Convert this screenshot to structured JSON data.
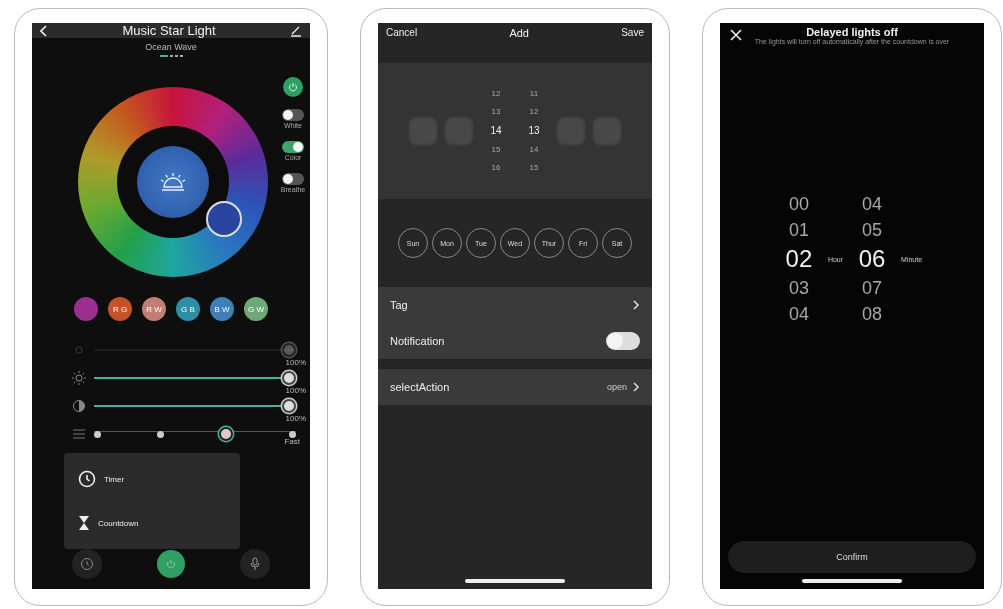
{
  "light_screen": {
    "title": "Music Star Light",
    "scene": "Ocean Wave",
    "scene_pages": [
      {
        "selected": true
      },
      {
        "selected": false
      },
      {
        "selected": false
      },
      {
        "selected": false
      }
    ],
    "power": {
      "on": true
    },
    "modes": [
      {
        "label": "White",
        "on": false
      },
      {
        "label": "Color",
        "on": true
      },
      {
        "label": "Breathe",
        "on": false
      }
    ],
    "swatches": [
      {
        "color": "#9a2f8f"
      },
      {
        "label": "R G",
        "color": "#c2542c"
      },
      {
        "label": "R W",
        "color": "#c07f72"
      },
      {
        "label": "G B",
        "color": "#2b8fa6"
      },
      {
        "label": "B W",
        "color": "#3d7fb6"
      },
      {
        "label": "G W",
        "color": "#6fa878"
      }
    ],
    "sliders": [
      {
        "kind": "blank",
        "disabled": true,
        "level": 1,
        "reading": "100%"
      },
      {
        "kind": "brightness",
        "disabled": false,
        "level": 1,
        "reading": "100%"
      },
      {
        "kind": "contrast",
        "disabled": false,
        "level": 1,
        "reading": "100%"
      }
    ],
    "speed": {
      "steps": [
        {
          "selected": false
        },
        {
          "selected": false
        },
        {
          "selected": true
        },
        {
          "selected": false
        }
      ],
      "label": "Fast"
    },
    "menu": [
      {
        "kind": "timer",
        "label": "Timer"
      },
      {
        "kind": "countdown",
        "label": "Countdown"
      }
    ],
    "bottom_power": {
      "on": true
    }
  },
  "schedule_screen": {
    "cancel": "Cancel",
    "title": "Add",
    "save": "Save",
    "hours": [
      {
        "value": "12",
        "selected": false
      },
      {
        "value": "13",
        "selected": false
      },
      {
        "value": "14",
        "selected": true
      },
      {
        "value": "15",
        "selected": false
      },
      {
        "value": "16",
        "selected": false
      }
    ],
    "minutes": [
      {
        "value": "11",
        "selected": false
      },
      {
        "value": "12",
        "selected": false
      },
      {
        "value": "13",
        "selected": true
      },
      {
        "value": "14",
        "selected": false
      },
      {
        "value": "15",
        "selected": false
      }
    ],
    "days": [
      {
        "label": "Sun",
        "selected": false
      },
      {
        "label": "Mon",
        "selected": false
      },
      {
        "label": "Tue",
        "selected": false
      },
      {
        "label": "Wed",
        "selected": false
      },
      {
        "label": "Thur",
        "selected": false
      },
      {
        "label": "Fri",
        "selected": false
      },
      {
        "label": "Sat",
        "selected": false
      }
    ],
    "tag": {
      "label": "Tag"
    },
    "notification": {
      "label": "Notification",
      "on": false
    },
    "action": {
      "label": "selectAction",
      "value": "open"
    }
  },
  "countdown_screen": {
    "title": "Delayed lights off",
    "subtitle": "The lights will turn off automatically after the countdown is over",
    "hours": [
      {
        "value": "00",
        "selected": false
      },
      {
        "value": "01",
        "selected": false
      },
      {
        "value": "02",
        "selected": true
      },
      {
        "value": "03",
        "selected": false
      },
      {
        "value": "04",
        "selected": false
      }
    ],
    "hour_unit": "Hour",
    "minutes": [
      {
        "value": "04",
        "selected": false
      },
      {
        "value": "05",
        "selected": false
      },
      {
        "value": "06",
        "selected": true
      },
      {
        "value": "07",
        "selected": false
      },
      {
        "value": "08",
        "selected": false
      }
    ],
    "minute_unit": "Minute",
    "confirm": "Confirm"
  }
}
